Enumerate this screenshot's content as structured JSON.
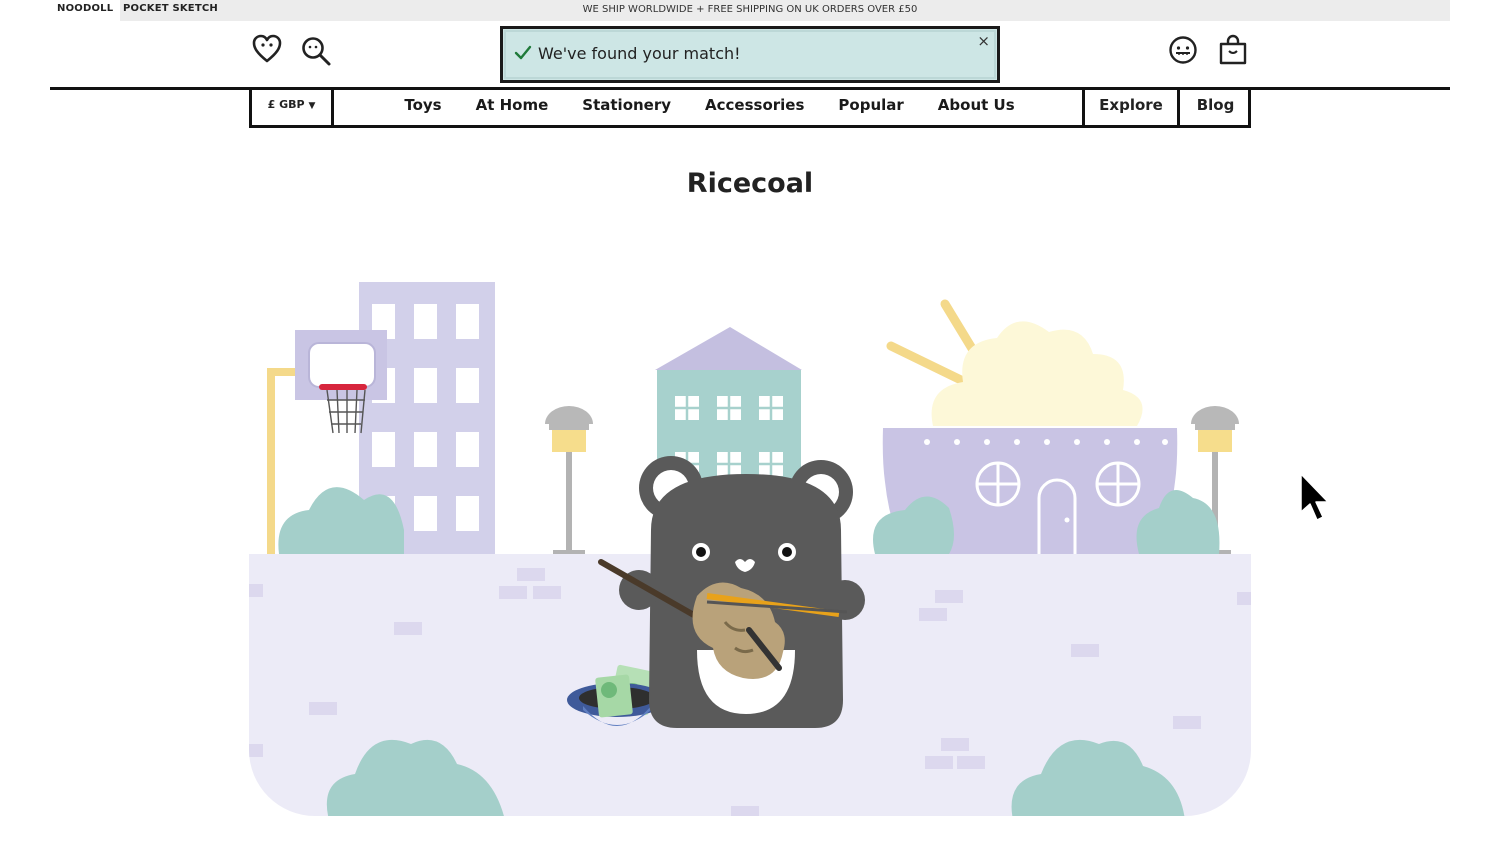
{
  "topbar": {
    "brand_1": "NOODOLL",
    "brand_2": "POCKET SKETCH",
    "shipping": "WE SHIP WORLDWIDE + FREE SHIPPING ON UK ORDERS OVER £50"
  },
  "header": {
    "icons": [
      "heart-icon",
      "search-icon",
      "account-face-icon",
      "shopping-bag-icon"
    ]
  },
  "toast": {
    "message": "We've found your match!",
    "close": "×"
  },
  "nav": {
    "currency": "£ GBP",
    "currency_arrow": "▼",
    "items": [
      {
        "label": "Toys"
      },
      {
        "label": "At Home"
      },
      {
        "label": "Stationery"
      },
      {
        "label": "Accessories"
      },
      {
        "label": "Popular"
      },
      {
        "label": "About Us"
      }
    ],
    "explore": "Explore",
    "blog": "Blog"
  },
  "page": {
    "title": "Ricecoal"
  },
  "colors": {
    "accent_teal": "#cde6e5",
    "ground": "#ecebf7",
    "building_lilac": "#d2d0ea",
    "bush": "#a4cfca",
    "character": "#5a5a5a"
  }
}
